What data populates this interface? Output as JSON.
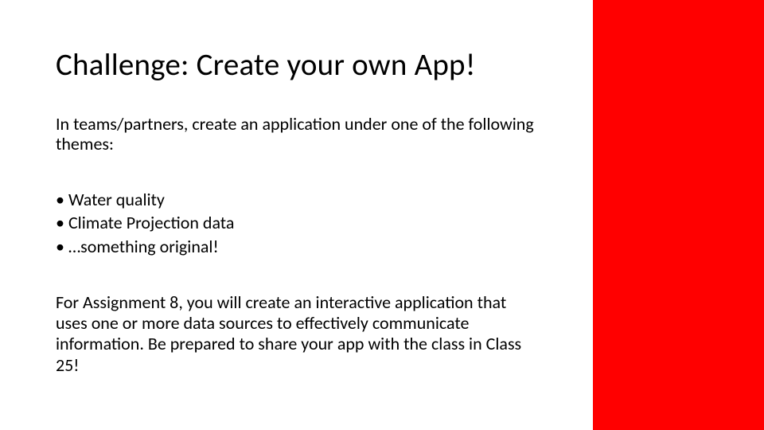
{
  "slide": {
    "title": "Challenge: Create your own App!",
    "intro": "In teams/partners, create an application under one of the following themes:",
    "bullets": [
      "Water quality",
      "Climate Projection data",
      "…something original!"
    ],
    "footer": "For Assignment 8, you will create an interactive application that uses one or more data sources to effectively communicate information.  Be prepared to share your app with the class in Class 25!"
  },
  "colors": {
    "accent": "#ff0000"
  }
}
